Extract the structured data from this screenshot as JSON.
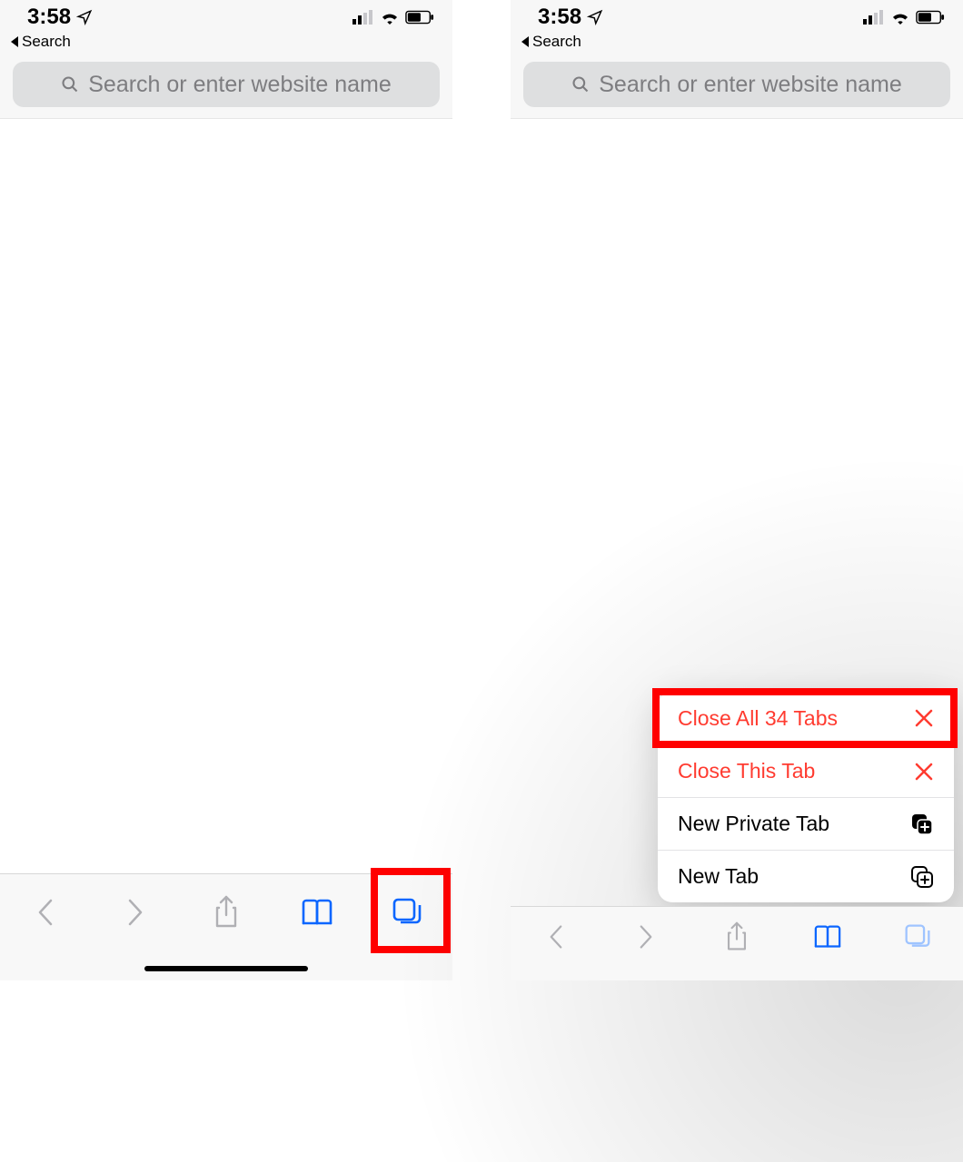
{
  "status": {
    "time": "3:58",
    "back_app_label": "Search"
  },
  "address": {
    "placeholder": "Search or enter website name"
  },
  "toolbar_icons": {
    "back": "chevron-left-icon",
    "forward": "chevron-right-icon",
    "share": "share-icon",
    "bookmarks": "book-icon",
    "tabs": "tabs-icon"
  },
  "tabs_menu": {
    "items": [
      {
        "label": "Close All 34 Tabs",
        "icon": "close-icon",
        "destructive": true
      },
      {
        "label": "Close This Tab",
        "icon": "close-icon",
        "destructive": true
      },
      {
        "label": "New Private Tab",
        "icon": "private-tab-icon",
        "destructive": false
      },
      {
        "label": "New Tab",
        "icon": "new-tab-icon",
        "destructive": false
      }
    ]
  },
  "colors": {
    "accent": "#0b66ff",
    "destructive": "#ff3b30",
    "highlight": "#ff0000"
  }
}
